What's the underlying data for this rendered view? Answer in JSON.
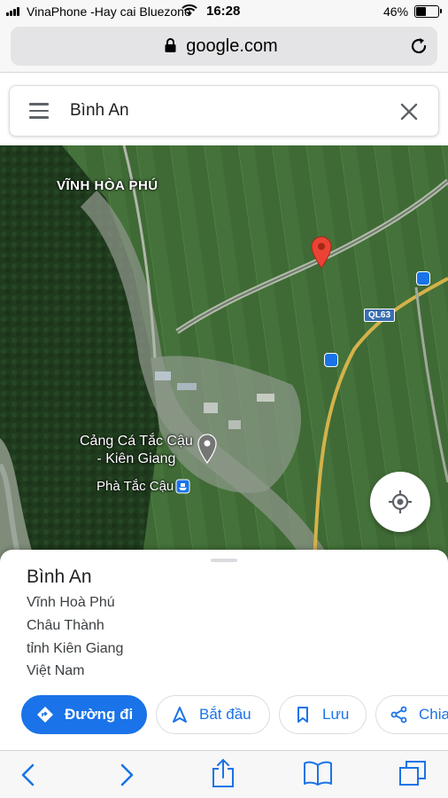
{
  "status_bar": {
    "carrier": "VinaPhone -Hay cai Bluezone",
    "time": "16:28",
    "battery_pct": "46%",
    "battery_level": 0.46
  },
  "browser": {
    "url": "google.com"
  },
  "search": {
    "query": "Bình An"
  },
  "map": {
    "labels": {
      "area": "VĨNH HÒA PHÚ",
      "port_line1": "Cảng Cá Tắc Cậu",
      "port_line2": "- Kiên Giang",
      "ferry": "Phà Tắc Cậu",
      "road": "QL63"
    },
    "colors": {
      "pin": "#ea4335",
      "transit": "#1a73e8",
      "road_badge": "#3a6fb0"
    }
  },
  "place": {
    "title": "Bình An",
    "address": [
      "Vĩnh Hoà Phú",
      "Châu Thành",
      "tỉnh Kiên Giang",
      "Việt Nam"
    ],
    "actions": {
      "directions": "Đường đi",
      "start": "Bắt đầu",
      "save": "Lưu",
      "share": "Chia"
    }
  },
  "theme": {
    "accent": "#1a73e8"
  }
}
